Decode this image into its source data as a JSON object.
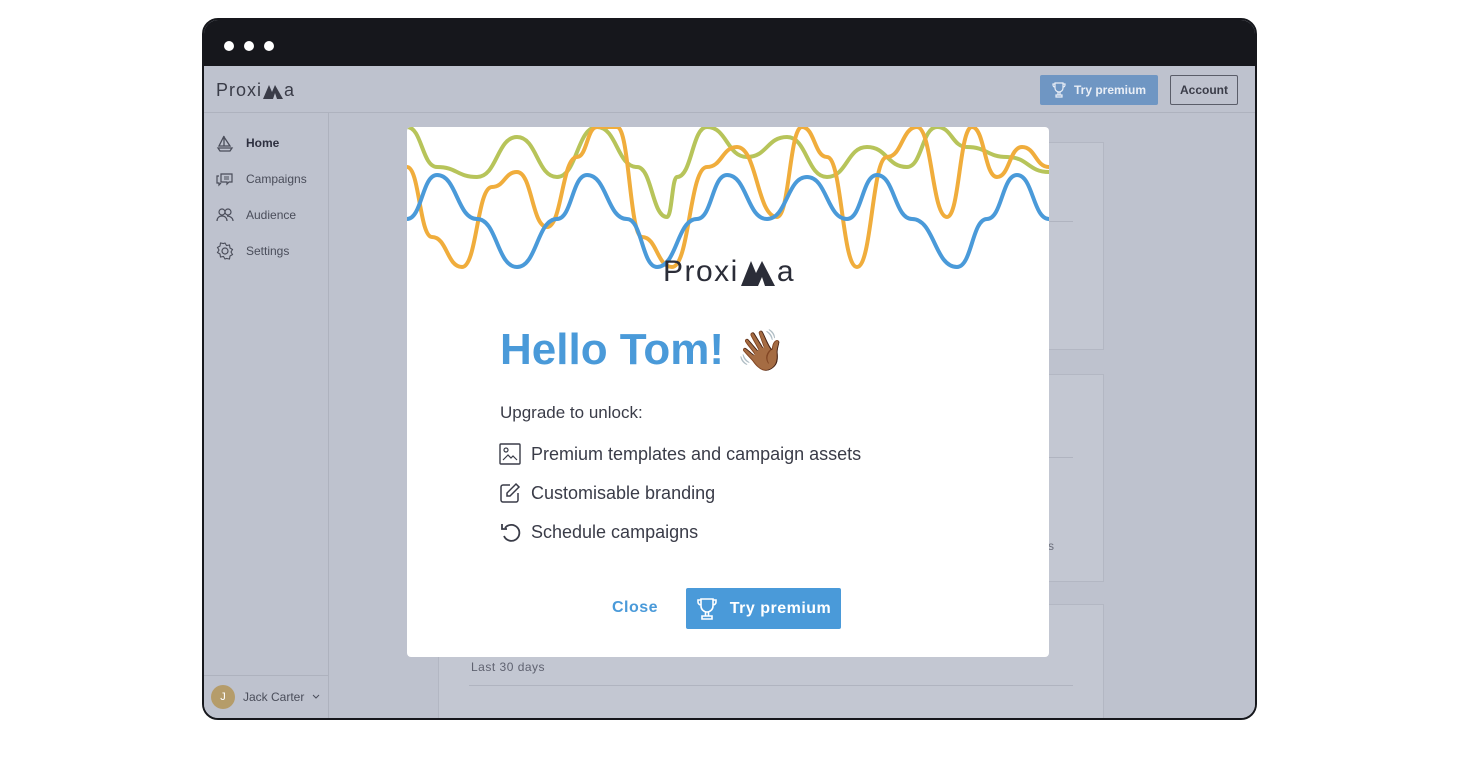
{
  "window": {
    "controls": [
      "dot",
      "dot",
      "dot"
    ]
  },
  "app": {
    "logo": {
      "part1": "Proxi",
      "part2": "a"
    },
    "topbar": {
      "try_premium": "Try premium",
      "account": "Account"
    },
    "sidebar": {
      "items": [
        {
          "label": "Home",
          "icon": "sailboat-icon",
          "active": true
        },
        {
          "label": "Campaigns",
          "icon": "chat-bubbles-icon",
          "active": false
        },
        {
          "label": "Audience",
          "icon": "people-icon",
          "active": false
        },
        {
          "label": "Settings",
          "icon": "gear-icon",
          "active": false
        }
      ],
      "user": {
        "initial": "J",
        "name": "Jack Carter"
      }
    },
    "background_content": {
      "last_30_days": "Last 30 days",
      "fragment": "s"
    }
  },
  "modal": {
    "logo": {
      "part1": "Proxi",
      "part2": "a"
    },
    "greeting": "Hello Tom!",
    "greeting_emoji": "👋🏾",
    "subheading": "Upgrade to unlock:",
    "features": [
      {
        "icon": "image-icon",
        "label": "Premium templates and campaign assets"
      },
      {
        "icon": "edit-icon",
        "label": "Customisable branding"
      },
      {
        "icon": "undo-icon",
        "label": "Schedule campaigns"
      }
    ],
    "close_label": "Close",
    "try_premium_label": "Try premium"
  },
  "colors": {
    "accent": "#4a9ad9",
    "wave_blue": "#4a9ad9",
    "wave_orange": "#f0ad3c",
    "wave_green": "#b7c45a",
    "frame": "#16171c",
    "overlay": "#bec2ce"
  }
}
